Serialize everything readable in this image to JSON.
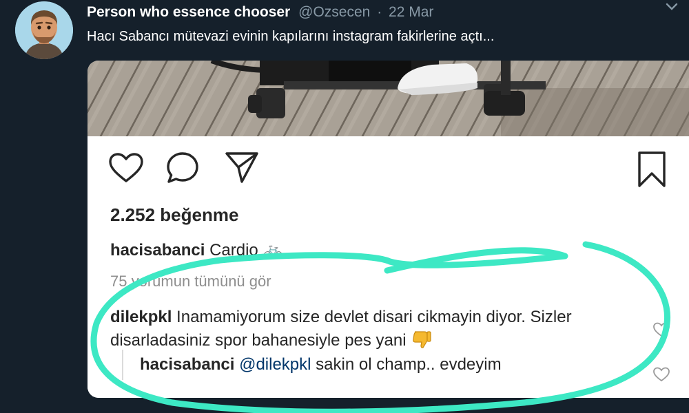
{
  "tweet": {
    "display_name": "Person who essence chooser",
    "handle": "@Ozsecen",
    "separator": "·",
    "date": "22 Mar",
    "text": "Hacı Sabancı mütevazi evinin kapılarını instagram fakirlerine açtı..."
  },
  "icons": {
    "avatar": "memoji-avatar",
    "more": "chevron-down-icon",
    "like": "heart-icon",
    "comment": "comment-bubble-icon",
    "share": "paper-plane-icon",
    "save": "bookmark-icon"
  },
  "instagram_post": {
    "likes": "2.252 beğenme",
    "caption_user": "hacisabanci",
    "caption_text": "Cardio",
    "caption_emoji": "🚲",
    "view_all_comments": "75 yorumun tümünü gör",
    "comment": {
      "user": "dilekpkl",
      "text": "Inamamiyorum size devlet disari cikmayin diyor. Sizler disarladasiniz spor bahanesiyle pes yani",
      "emoji": "👎"
    },
    "reply": {
      "user": "hacisabanci",
      "mention": "@dilekpkl",
      "text": "sakin ol champ.. evdeyim"
    }
  },
  "colors": {
    "background": "#15202b",
    "secondary_text": "#8899a6",
    "highlight": "#3de8c4",
    "mention": "#003569"
  }
}
